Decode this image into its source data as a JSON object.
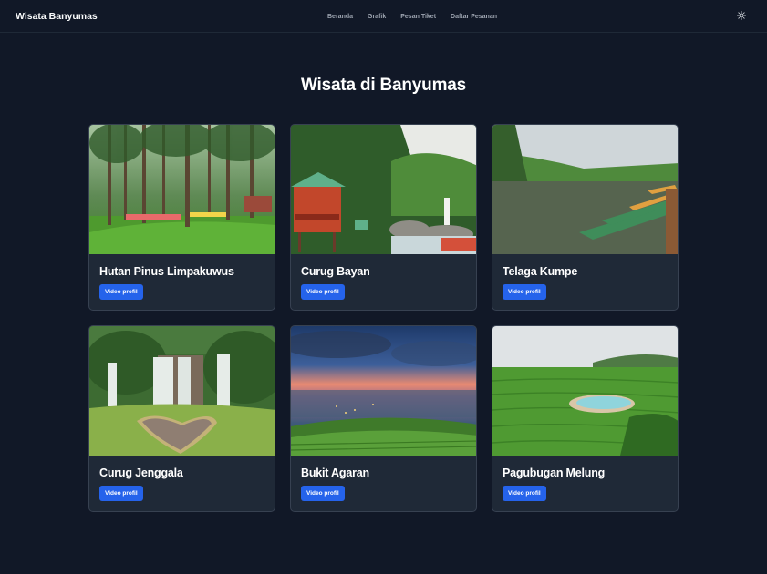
{
  "nav": {
    "brand": "Wisata Banyumas",
    "links": [
      "Beranda",
      "Grafik",
      "Pesan Tiket",
      "Daftar Pesanan"
    ],
    "theme_icon": "sun-icon"
  },
  "page": {
    "title": "Wisata di Banyumas"
  },
  "cards": [
    {
      "title": "Hutan Pinus Limpakuwus",
      "button": "Video profil"
    },
    {
      "title": "Curug Bayan",
      "button": "Video profil"
    },
    {
      "title": "Telaga Kumpe",
      "button": "Video profil"
    },
    {
      "title": "Curug Jenggala",
      "button": "Video profil"
    },
    {
      "title": "Bukit Agaran",
      "button": "Video profil"
    },
    {
      "title": "Pagubugan Melung",
      "button": "Video profil"
    }
  ],
  "colors": {
    "background": "#111827",
    "card": "#1f2937",
    "accent": "#2563eb"
  }
}
